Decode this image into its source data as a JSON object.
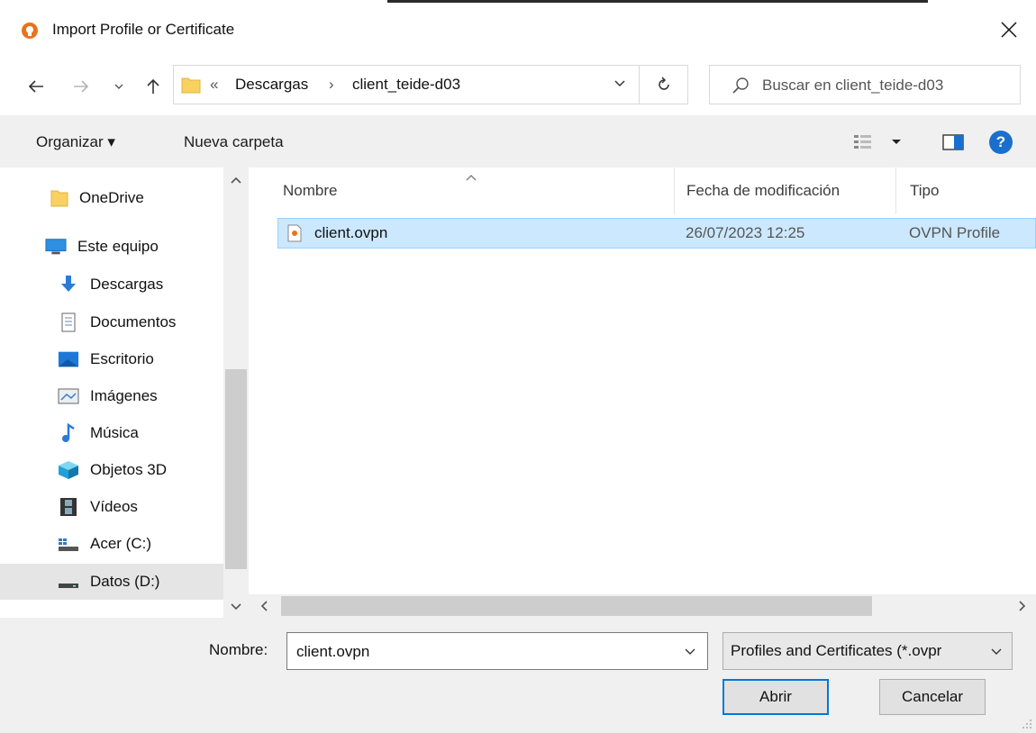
{
  "window": {
    "title": "Import Profile or Certificate",
    "accent_color": "#e8731d"
  },
  "nav": {
    "breadcrumb_overflow": "«",
    "breadcrumb": [
      "Descargas",
      "client_teide-d03"
    ],
    "separator": "›",
    "search_placeholder": "Buscar en client_teide-d03"
  },
  "toolbar": {
    "organize_label": "Organizar ▾",
    "new_folder_label": "Nueva carpeta",
    "help_label": "?"
  },
  "sidebar": {
    "items": [
      {
        "label": "OneDrive",
        "icon": "onedrive-folder-icon"
      },
      {
        "label": "Este equipo",
        "icon": "computer-icon"
      },
      {
        "label": "Descargas",
        "icon": "downloads-icon"
      },
      {
        "label": "Documentos",
        "icon": "documents-icon"
      },
      {
        "label": "Escritorio",
        "icon": "desktop-icon"
      },
      {
        "label": "Imágenes",
        "icon": "pictures-icon"
      },
      {
        "label": "Música",
        "icon": "music-icon"
      },
      {
        "label": "Objetos 3D",
        "icon": "3d-objects-icon"
      },
      {
        "label": "Vídeos",
        "icon": "videos-icon"
      },
      {
        "label": "Acer (C:)",
        "icon": "drive-c-icon"
      },
      {
        "label": "Datos (D:)",
        "icon": "drive-d-icon",
        "selected": true
      }
    ]
  },
  "files": {
    "columns": [
      "Nombre",
      "Fecha de modificación",
      "Tipo"
    ],
    "rows": [
      {
        "name": "client.ovpn",
        "modified": "26/07/2023 12:25",
        "type": "OVPN Profile",
        "selected": true
      }
    ]
  },
  "footer": {
    "filename_label": "Nombre:",
    "filename_value": "client.ovpn",
    "filter_value": "Profiles and Certificates (*.ovpr",
    "open_label": "Abrir",
    "cancel_label": "Cancelar"
  },
  "colors": {
    "selection_bg": "#cce8ff",
    "selection_border": "#99d1ff",
    "primary_button_border": "#0078d7",
    "help_blue": "#1a6fcd",
    "folder_yellow": "#f8d162"
  }
}
